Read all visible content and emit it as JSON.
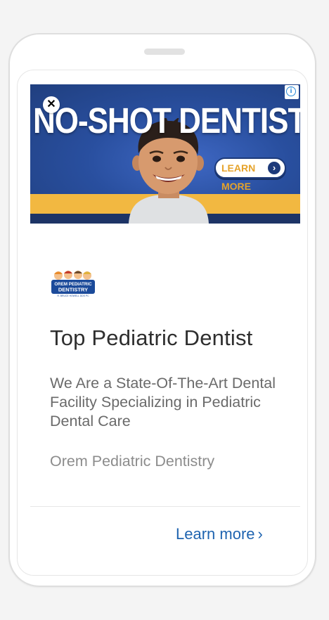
{
  "ad": {
    "banner_headline": "NO-SHOT DENTISTRY",
    "banner_cta": "LEARN MORE",
    "close_glyph": "✕",
    "info_glyph": "i",
    "logo_line1": "OREM PEDIATRIC",
    "logo_line2": "DENTISTRY",
    "logo_line3": "R. BRUCE HOWELL DDS PC",
    "title": "Top Pediatric Dentist",
    "description": "We Are a State-Of-The-Art Dental Facility Specializing in Pediatric Dental Care",
    "advertiser": "Orem Pediatric Dentistry",
    "learn_more": "Learn more",
    "learn_more_arrow": "›"
  },
  "colors": {
    "banner_blue": "#294f9f",
    "banner_yellow": "#f2b841",
    "link_blue": "#1f64b0",
    "title_text": "#2e2e2e"
  },
  "icons": [
    "close-icon",
    "info-icon",
    "chevron-right-icon"
  ]
}
